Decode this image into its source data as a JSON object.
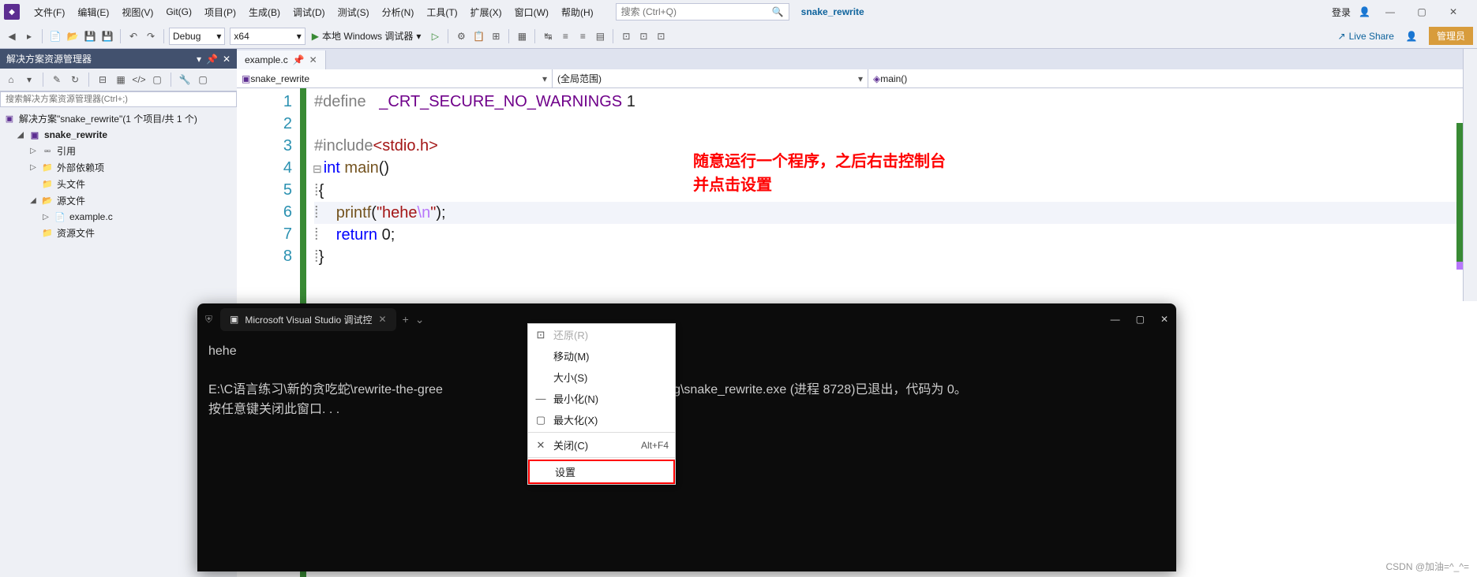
{
  "menu": {
    "items": [
      "文件(F)",
      "编辑(E)",
      "视图(V)",
      "Git(G)",
      "项目(P)",
      "生成(B)",
      "调试(D)",
      "测试(S)",
      "分析(N)",
      "工具(T)",
      "扩展(X)",
      "窗口(W)",
      "帮助(H)"
    ],
    "search_placeholder": "搜索 (Ctrl+Q)",
    "project": "snake_rewrite",
    "login": "登录",
    "admin": "管理员"
  },
  "toolbar": {
    "config": "Debug",
    "platform": "x64",
    "debug_btn": "本地 Windows 调试器",
    "liveshare": "Live Share"
  },
  "solution_explorer": {
    "title": "解决方案资源管理器",
    "search_placeholder": "搜索解决方案资源管理器(Ctrl+;)",
    "root": "解决方案\"snake_rewrite\"(1 个项目/共 1 个)",
    "project": "snake_rewrite",
    "refs": "引用",
    "external": "外部依赖项",
    "headers": "头文件",
    "sources": "源文件",
    "file1": "example.c",
    "resources": "资源文件"
  },
  "editor": {
    "tab": "example.c",
    "nav1": "snake_rewrite",
    "nav2": "(全局范围)",
    "nav3": "main()",
    "code": {
      "l1_def": "#define   ",
      "l1_macro": "_CRT_SECURE_NO_WARNINGS",
      "l1_val": " 1",
      "l3_inc": "#include",
      "l3_path": "<stdio.h>",
      "l4_int": "int",
      "l4_main": " main",
      "l4_paren": "()",
      "l5": "{",
      "l6_indent": "    ",
      "l6_fn": "printf",
      "l6_p1": "(",
      "l6_s1": "\"hehe",
      "l6_esc": "\\n",
      "l6_s2": "\"",
      "l6_p2": ");",
      "l7_indent": "    ",
      "l7_ret": "return",
      "l7_val": " 0;",
      "l8": "}"
    },
    "annotation_l1": "随意运行一个程序，之后右击控制台",
    "annotation_l2": "并点击设置"
  },
  "console": {
    "tab_title": "Microsoft Visual Studio 调试控",
    "output_l1": "hehe",
    "output_l2": "E:\\C语言练习\\新的贪吃蛇\\rewrite-the-gree",
    "output_l2b": "ite\\x64\\Debug\\snake_rewrite.exe (进程 8728)已退出，代码为 0。",
    "output_l3": "按任意键关闭此窗口. . ."
  },
  "context_menu": {
    "restore": "还原(R)",
    "move": "移动(M)",
    "size": "大小(S)",
    "minimize": "最小化(N)",
    "maximize": "最大化(X)",
    "close": "关闭(C)",
    "close_key": "Alt+F4",
    "settings": "设置"
  },
  "watermark": "CSDN @加油=^_^="
}
